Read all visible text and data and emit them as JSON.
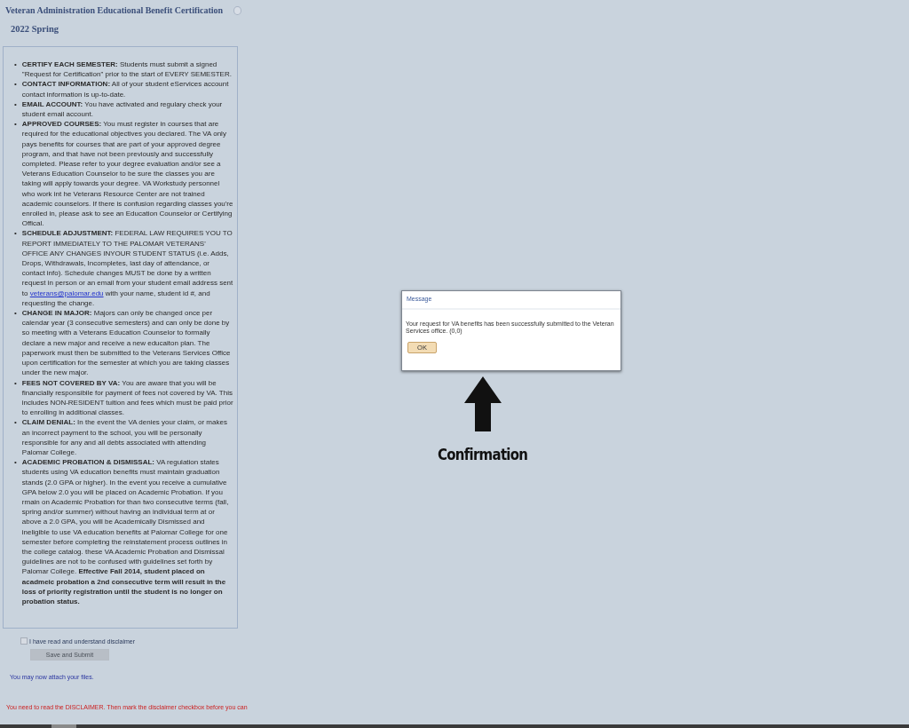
{
  "page": {
    "title": "Veteran Administration Educational Benefit Certification",
    "term": "2022 Spring"
  },
  "disclaimer": {
    "items": [
      {
        "bullet": "•",
        "heading": "CERTIFY EACH SEMESTER:",
        "text": "Students must submit a signed \"Request for Certification\" prior to the start of EVERY SEMESTER."
      },
      {
        "bullet": "•",
        "heading": "CONTACT INFORMATION:",
        "text": "All of your student eServices account contact information is up-to-date."
      },
      {
        "bullet": "•",
        "heading": "EMAIL ACCOUNT:",
        "text": "You have activated and regulary check your student email account."
      },
      {
        "bullet": "•",
        "heading": "APPROVED COURSES:",
        "text": "You must register in courses that are required for the educational objectives you declared.  The VA only pays benefits for courses that are part of your approved degree program, and that have not been previously and successfully completed.  Please refer to your degree evaluation and/or see a Veterans Education Counselor to be sure the classes you are taking will apply towards your degree.  VA Workstudy personnel who work int he Veterans Resource Center are not trained academic counselors.  If there is confusion regarding classes you're enrolled in, please ask to see an Education Counselor or Certifying Offical."
      },
      {
        "bullet": "•",
        "heading": "SCHEDULE ADJUSTMENT:",
        "text": "FEDERAL LAW REQUIRES YOU TO REPORT IMMEDIATELY TO THE PALOMAR VETERANS' OFFICE ANY CHANGES INYOUR STUDENT STATUS (i.e. Adds, Drops, Withdrawals, Incompletes, last day of attendance, or contact info).  Schedule changes MUST be done by a written request in person or an email from your student email address sent to",
        "link": "veterans@palomar.edu",
        "text_after": "with your name, student id #, and requesting the change."
      },
      {
        "bullet": "•",
        "heading": "CHANGE IN MAJOR:",
        "text": "Majors can only be changed once per calendar year (3 consecutive semesters) and can only be done by so meeting with a Veterans Education Counselor to formally declare a new major and receive a new educaiton plan.  The paperwork must then be submitted to the Veterans Services Office upon certification for the semester at which you are taking classes under the new major."
      },
      {
        "bullet": "•",
        "heading": "FEES NOT COVERED BY VA:",
        "text": "You are aware that you will be financially responsibile for payment of fees not covered by VA.  This includes NON-RESIDENT tuition and fees which must be paid prior to enrolling in additional classes."
      },
      {
        "bullet": "•",
        "heading": "CLAIM DENIAL:",
        "text": "In the event the VA denies your claim, or makes an incorrect payment to the school, you will be personally responsible for any and all debts associated with attending Palomar College."
      },
      {
        "bullet": "•",
        "heading": "ACADEMIC PROBATION & DISMISSAL:",
        "text": "VA regulation states students using VA education benefits must maintain graduation stands (2.0 GPA or higher).  In the event you receive a cumulative GPA below 2.0 you will be placed on Academic Probation.  If you rmain on Academic Probation for than two consecutive terms (fall, spring and/or summer) without having an individual term at or above a 2.0 GPA, you will be Academically Dismissed and ineligible to use VA education benefits at Palomar College for one semester before completing the reinstatement process outlines in the college catalog.  these VA Academic Probation and Dismissal guidelines are not to be confused with guidelines set forth by Palomar College. **Effective Fall 2014, student placed on acadmeic probation a 2nd consecutive term will result in the loss of priority registration until the student is no longer on probation status.**"
      }
    ]
  },
  "agree": {
    "label": "I have read and understand disclaimer",
    "checked": false
  },
  "submit": {
    "label": "Save and Submit",
    "disabled": true
  },
  "attach_note": "You may now attach your files.",
  "warning": "You need to read the DISCLAIMER. Then mark the disclaimer checkbox before you can",
  "dialog": {
    "title": "Message",
    "message": "Your request for VA benefits has been successfully submitted to the Veteran Services office. (0,0)",
    "button": "OK"
  },
  "annotation": {
    "label": "Confirmation"
  }
}
